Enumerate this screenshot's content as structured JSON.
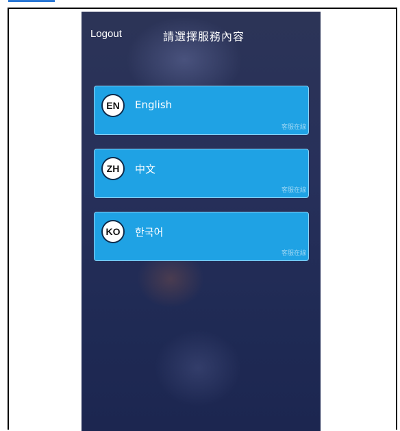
{
  "header": {
    "logout_label": "Logout",
    "title": "請選擇服務內容"
  },
  "languages": [
    {
      "code": "EN",
      "label": "English",
      "status": "客服在線"
    },
    {
      "code": "ZH",
      "label": "中文",
      "status": "客服在線"
    },
    {
      "code": "KO",
      "label": "한국어",
      "status": "客服在線"
    }
  ],
  "colors": {
    "card_background": "#1fa2e4",
    "page_background": "#27305a",
    "badge_border": "#0d2a4a"
  }
}
